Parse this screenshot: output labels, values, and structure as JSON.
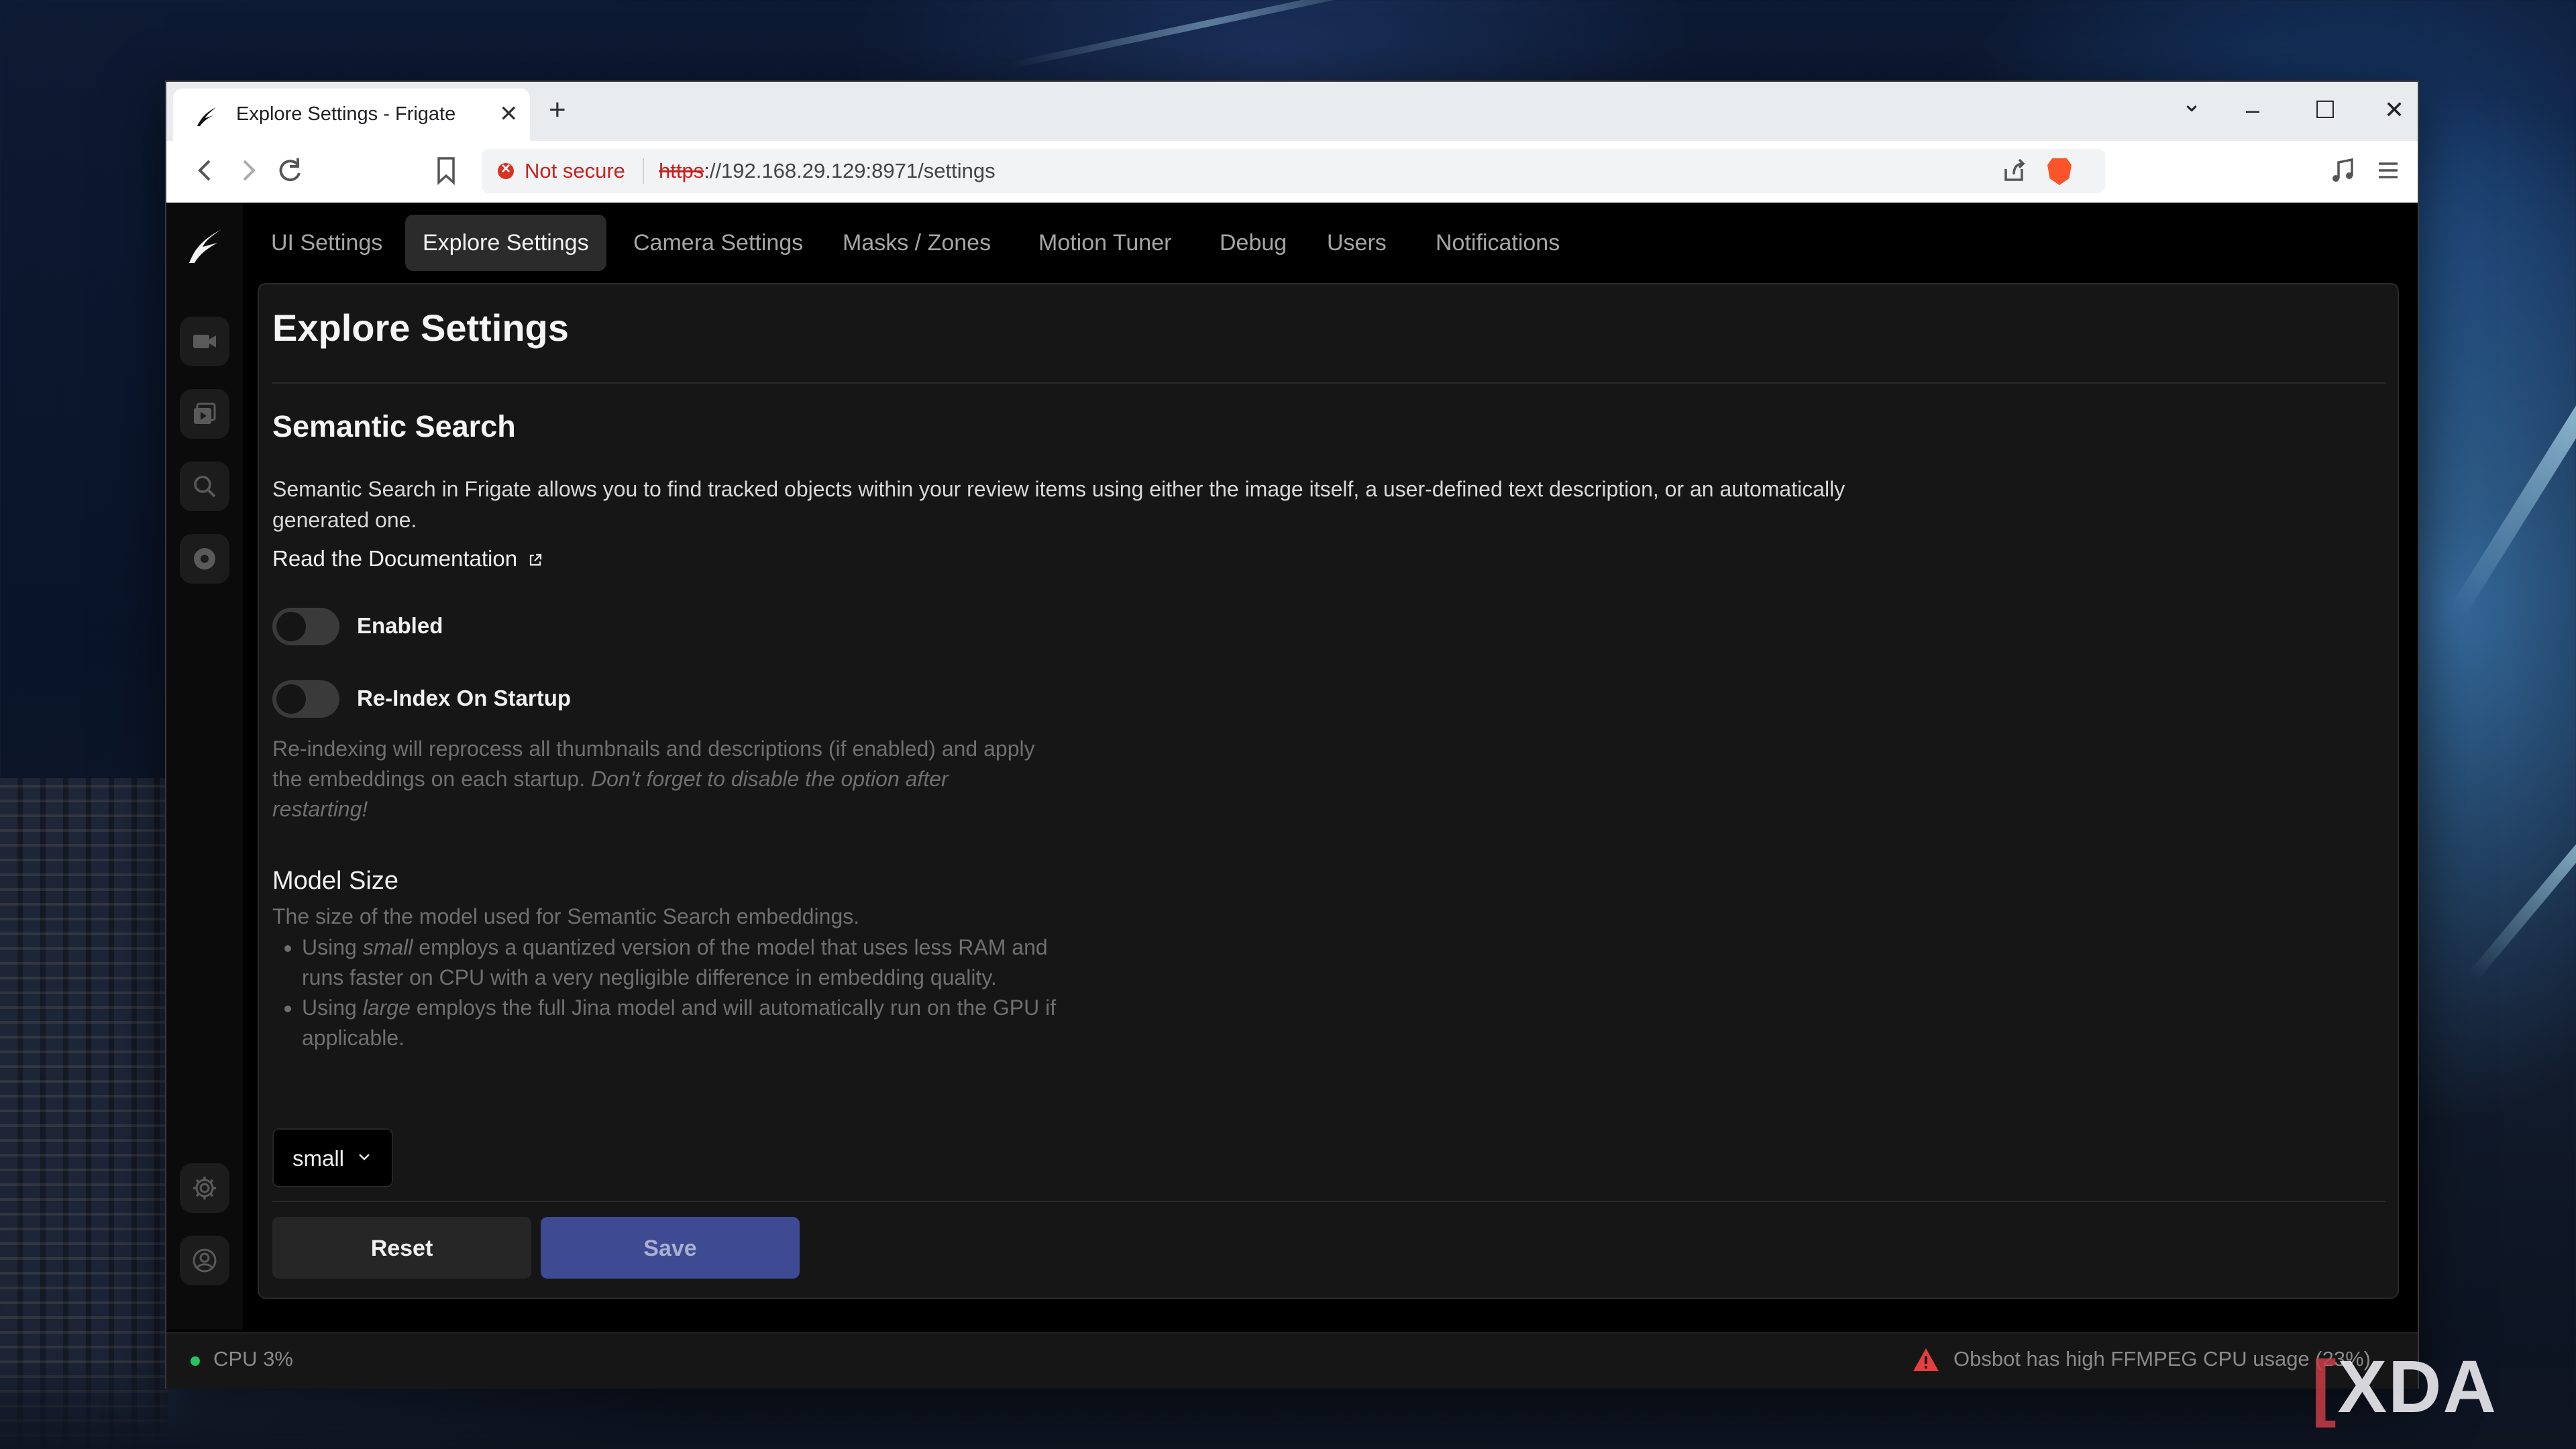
{
  "browser": {
    "tab_title": "Explore Settings - Frigate",
    "tab_close": "✕",
    "new_tab": "+",
    "security_label": "Not secure",
    "url_scheme": "https",
    "url_rest": "://192.168.29.129:8971/settings",
    "icons": [
      "back-icon",
      "forward-icon",
      "reload-icon",
      "bookmark-icon",
      "share-icon",
      "brave-shields-icon",
      "media-icon",
      "menu-icon"
    ]
  },
  "window_controls": {
    "minimize": "–",
    "maximize": "☐",
    "close": "✕",
    "tab_list": "⌄"
  },
  "nav": {
    "tabs": [
      {
        "label": "UI Settings",
        "active": false
      },
      {
        "label": "Explore Settings",
        "active": true
      },
      {
        "label": "Camera Settings",
        "active": false
      },
      {
        "label": "Masks / Zones",
        "active": false
      },
      {
        "label": "Motion Tuner",
        "active": false
      },
      {
        "label": "Debug",
        "active": false
      },
      {
        "label": "Users",
        "active": false
      },
      {
        "label": "Notifications",
        "active": false
      }
    ]
  },
  "sidebar": {
    "items": [
      "live-icon",
      "review-icon",
      "explore-icon",
      "export-icon",
      "settings-icon",
      "account-icon"
    ]
  },
  "page": {
    "title": "Explore Settings",
    "section_title": "Semantic Search",
    "description": "Semantic Search in Frigate allows you to find tracked objects within your review items using either the image itself, a user-defined text description, or an automatically generated one.",
    "doc_link": "Read the Documentation",
    "enabled_label": "Enabled",
    "enabled_on": false,
    "reindex_label": "Re-Index On Startup",
    "reindex_on": false,
    "reindex_help_plain": "Re-indexing will reprocess all thumbnails and descriptions (if enabled) and apply the embeddings on each startup. ",
    "reindex_help_italic": "Don't forget to disable the option after restarting!",
    "model_size_title": "Model Size",
    "model_size_desc": "The size of the model used for Semantic Search embeddings.",
    "bullet1_pre": "Using ",
    "bullet1_em": "small",
    "bullet1_post": " employs a quantized version of the model that uses less RAM and runs faster on CPU with a very negligible difference in embedding quality.",
    "bullet2_pre": "Using ",
    "bullet2_em": "large",
    "bullet2_post": " employs the full Jina model and will automatically run on the GPU if applicable.",
    "model_size_value": "small",
    "reset_label": "Reset",
    "save_label": "Save"
  },
  "status": {
    "cpu": "CPU 3%",
    "warning": "Obsbot has high FFMPEG CPU usage (23%)"
  },
  "watermark": {
    "bracket": "[",
    "text": "XDA"
  },
  "colors": {
    "accent_save": "#3e4a92",
    "not_secure": "#c5221f",
    "cpu_ok": "#22c55e",
    "warning": "#e53e3e"
  }
}
